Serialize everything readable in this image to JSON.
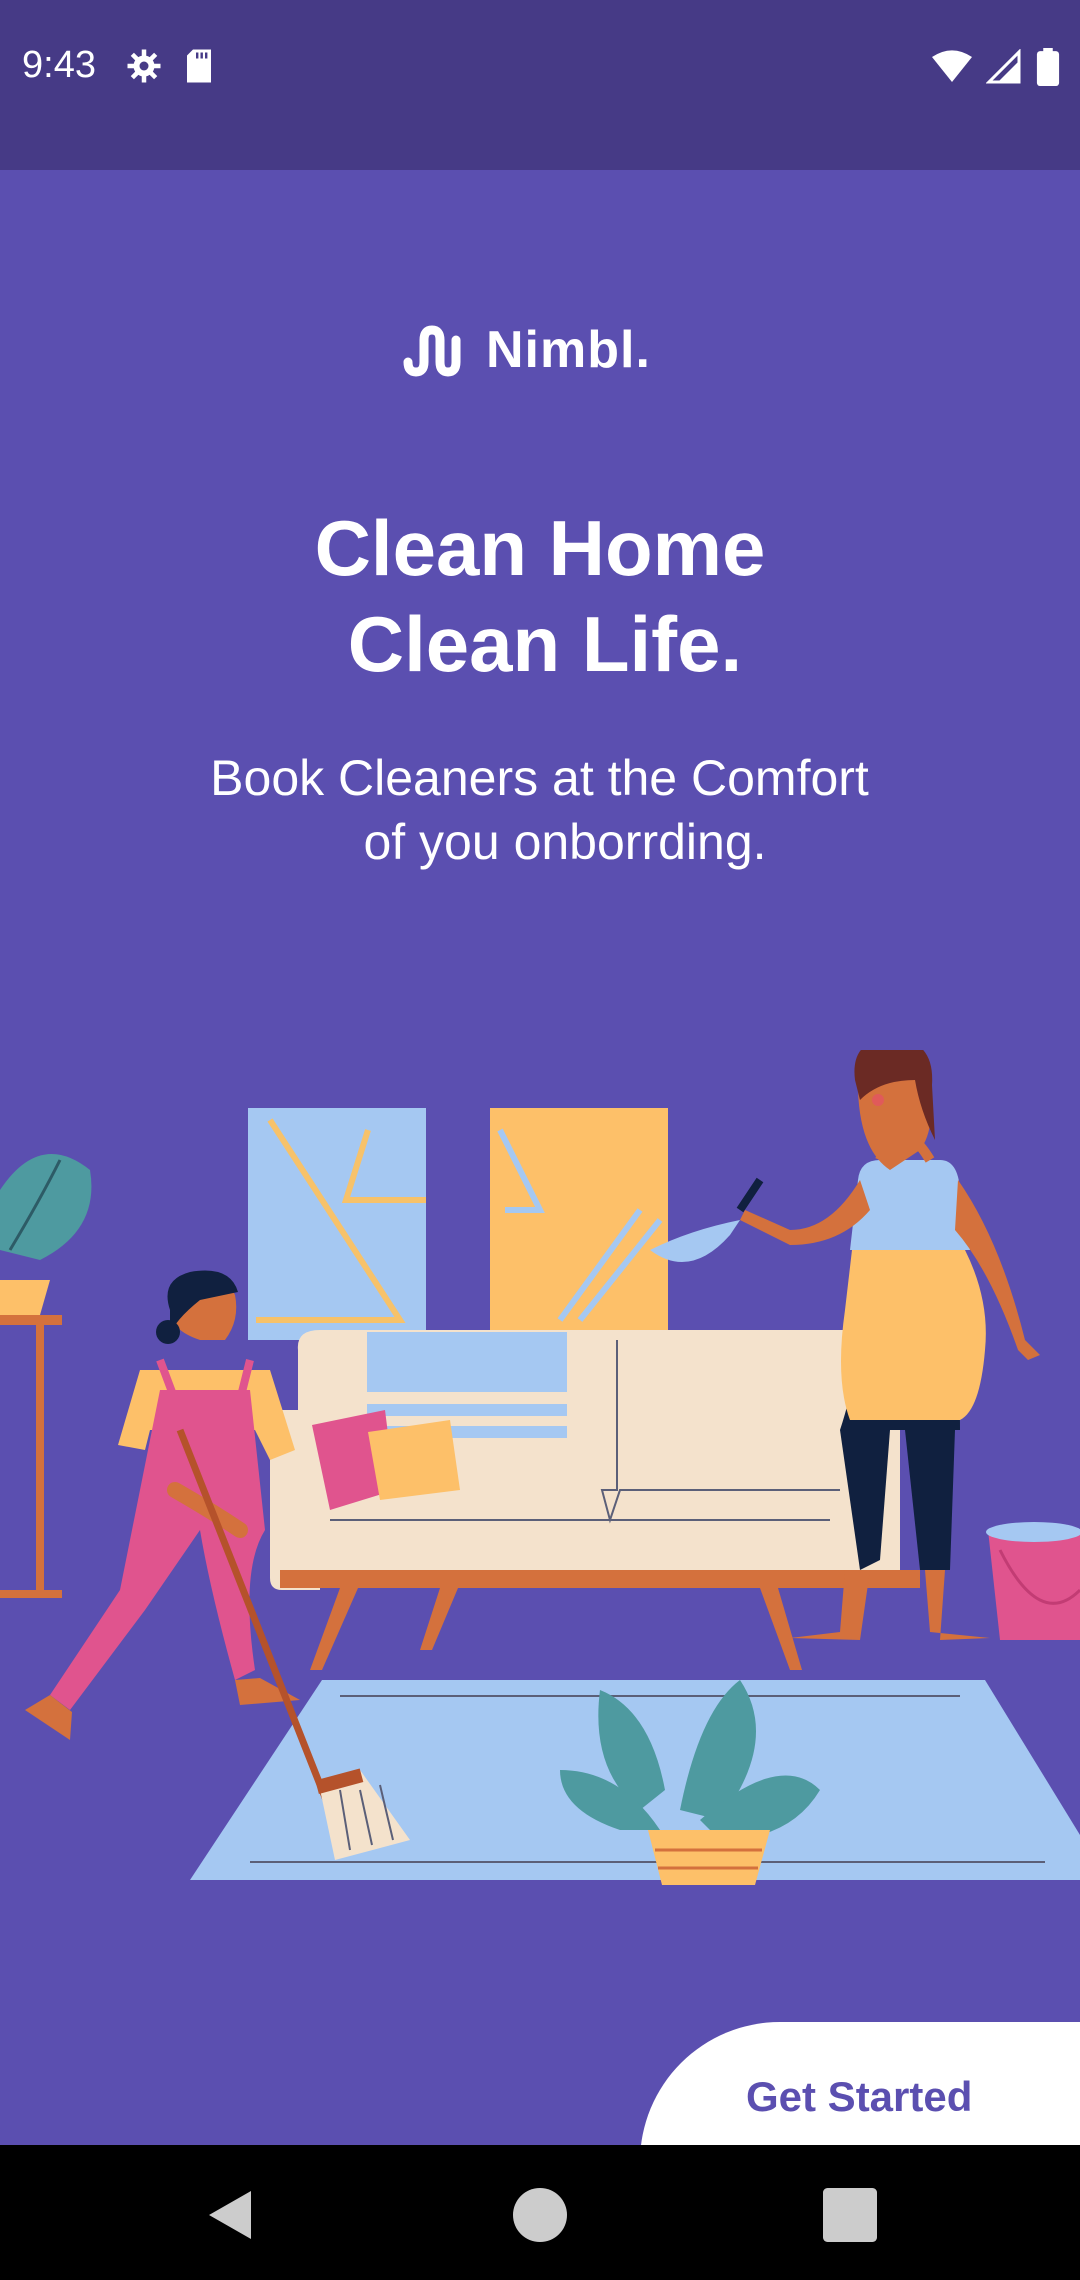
{
  "status_bar": {
    "time": "9:43",
    "left_icons": [
      "settings-icon",
      "sd-card-icon"
    ],
    "right_icons": [
      "wifi-icon",
      "cell-signal-icon",
      "battery-icon"
    ]
  },
  "logo": {
    "text": "Nimbl."
  },
  "headline": {
    "line1": "Clean Home",
    "line2": "Clean Life."
  },
  "subtext": {
    "line1": "Book Cleaners at the Comfort",
    "line2": "of you onborrding."
  },
  "cta": {
    "label": "Get Started"
  },
  "nav_bar": {
    "buttons": [
      "back-icon",
      "home-icon",
      "recents-icon"
    ]
  },
  "colors": {
    "background": "#5b4fb0",
    "status_bar": "#463a86",
    "accent_text": "#5b4fb0"
  }
}
